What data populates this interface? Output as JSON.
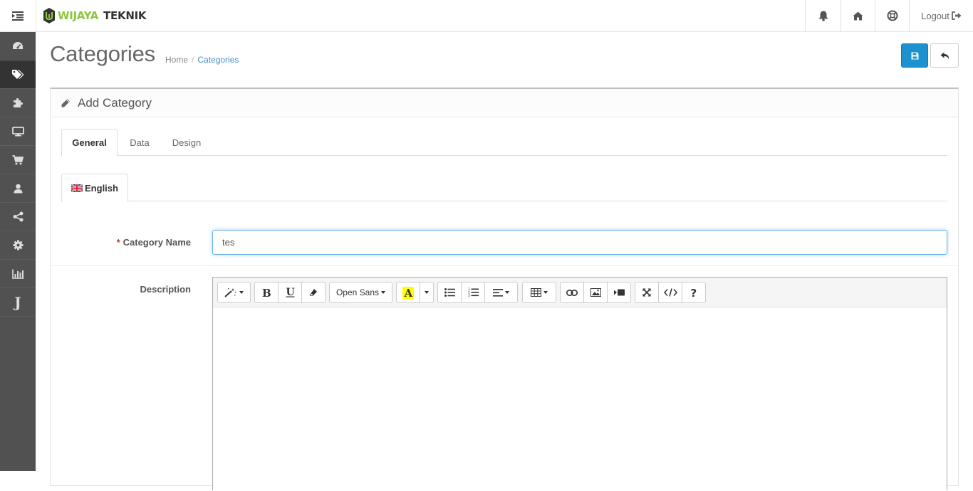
{
  "header": {
    "brand_part1": "WIJAYA",
    "brand_part2": "TEKNIK",
    "logout_label": "Logout",
    "icons": [
      "menu-toggle-icon",
      "bell-icon",
      "home-icon",
      "life-ring-icon",
      "sign-out-icon"
    ]
  },
  "sidebar": {
    "items": [
      {
        "icon": "dashboard-icon",
        "active": false
      },
      {
        "icon": "tags-icon",
        "active": true
      },
      {
        "icon": "puzzle-piece-icon",
        "active": false
      },
      {
        "icon": "desktop-icon",
        "active": false
      },
      {
        "icon": "shopping-cart-icon",
        "active": false
      },
      {
        "icon": "user-icon",
        "active": false
      },
      {
        "icon": "share-alt-icon",
        "active": false
      },
      {
        "icon": "cog-icon",
        "active": false
      },
      {
        "icon": "bar-chart-icon",
        "active": false
      },
      {
        "icon": "j-letter-icon",
        "label": "J",
        "active": false
      }
    ]
  },
  "page": {
    "title": "Categories",
    "breadcrumb": [
      "Home",
      "Categories"
    ],
    "actions": {
      "save": "save-icon",
      "back": "reply-icon"
    }
  },
  "panel": {
    "title": "Add Category",
    "tabs": [
      {
        "label": "General",
        "active": true
      },
      {
        "label": "Data",
        "active": false
      },
      {
        "label": "Design",
        "active": false
      }
    ],
    "language_tab": {
      "label": "English",
      "flag": "uk-flag-icon"
    },
    "form": {
      "name_label": "Category Name",
      "required_mark": "*",
      "name_value": "tes",
      "description_label": "Description"
    },
    "editor": {
      "font_label": "Open Sans",
      "highlight_color": "#ffff00",
      "accent": "#1e91cf"
    }
  }
}
